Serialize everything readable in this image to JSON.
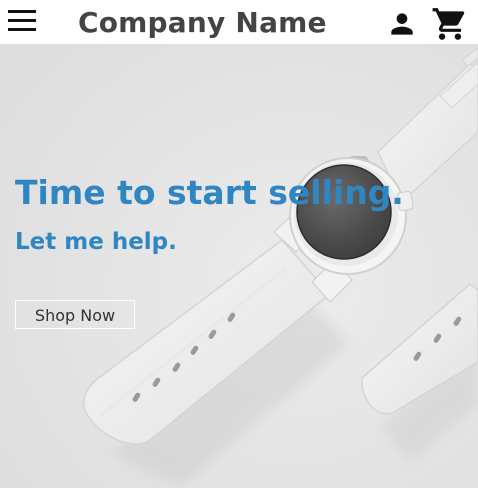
{
  "header": {
    "brand": "Company Name",
    "icons": [
      "menu-icon",
      "account-icon",
      "shopping-cart-icon"
    ]
  },
  "hero": {
    "headline": "Time to start selling.",
    "subheadline": "Let me help.",
    "cta_label": "Shop Now",
    "image": "white-smartwatch"
  },
  "colors": {
    "accent": "#2f86c2",
    "brand_text": "#444444",
    "hero_background": "#e6e6e6",
    "header_background": "#ffffff"
  }
}
